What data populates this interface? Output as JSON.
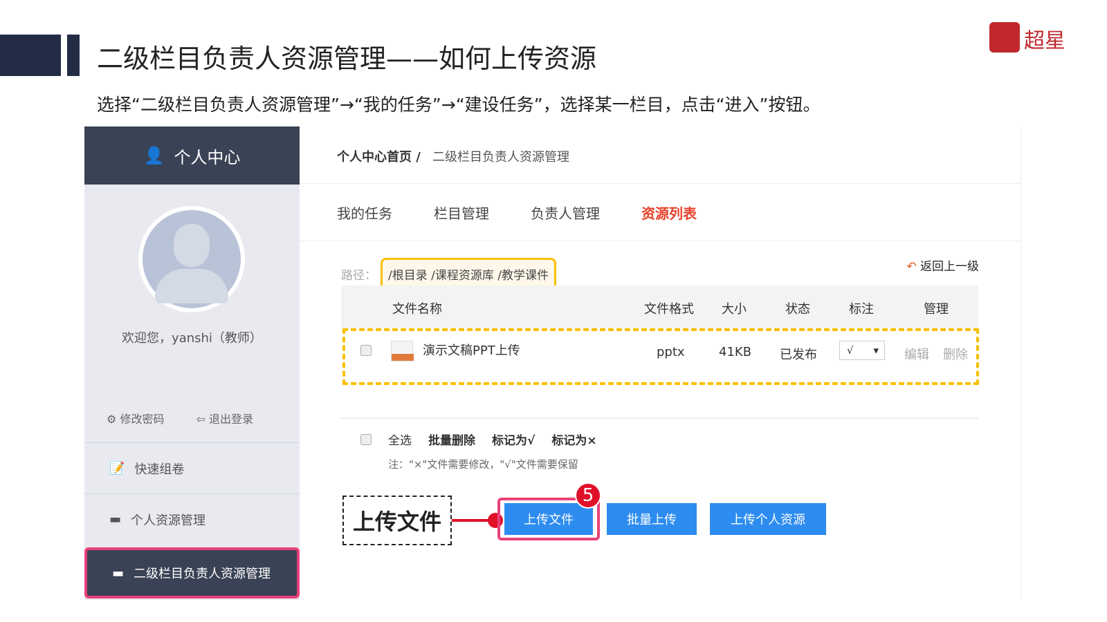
{
  "slide": {
    "title": "二级栏目负责人资源管理——如何上传资源",
    "subtitle": "选择“二级栏目负责人资源管理”→“我的任务”→“建设任务”，选择某一栏目，点击“进入”按钮。",
    "logo_text": "超星"
  },
  "sidebar": {
    "header": "个人中心",
    "welcome": "欢迎您，yanshi（教师）",
    "change_password": "修改密码",
    "logout": "退出登录",
    "items": [
      {
        "label": "快速组卷"
      },
      {
        "label": "个人资源管理"
      },
      {
        "label": "二级栏目负责人资源管理"
      }
    ]
  },
  "breadcrumb": {
    "home": "个人中心首页 /",
    "current": "二级栏目负责人资源管理"
  },
  "tabs": [
    {
      "label": "我的任务"
    },
    {
      "label": "栏目管理"
    },
    {
      "label": "负责人管理"
    },
    {
      "label": "资源列表"
    }
  ],
  "path": {
    "label": "路径：",
    "value": "/根目录 /课程资源库 /教学课件",
    "back": "返回上一级"
  },
  "table": {
    "headers": [
      "文件名称",
      "文件格式",
      "大小",
      "状态",
      "标注",
      "管理"
    ],
    "rows": [
      {
        "name": "演示文稿PPT上传",
        "format": "pptx",
        "size": "41KB",
        "status": "已发布",
        "mark": "√",
        "edit": "编辑",
        "delete": "删除"
      }
    ]
  },
  "bulk": {
    "select_all": "全选",
    "batch_delete": "批量删除",
    "mark_ok": "标记为√",
    "mark_x": "标记为×",
    "note": "注：\"×\"文件需要修改，\"√\"文件需要保留"
  },
  "callout": {
    "label": "上传文件",
    "step": "5"
  },
  "buttons": {
    "upload": "上传文件",
    "batch_upload": "批量上传",
    "upload_personal": "上传个人资源"
  }
}
